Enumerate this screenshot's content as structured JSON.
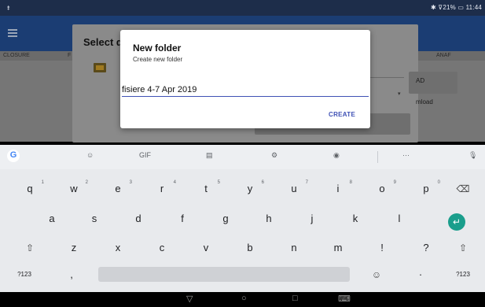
{
  "status_bar": {
    "left_icon": "usb-icon",
    "right_text": "✱ ⊽21% ▭ 11:44"
  },
  "app_bar": {
    "menu_icon": "hamburger-menu-icon"
  },
  "tabs": [
    "CLOSURE",
    "F",
    "ANAF"
  ],
  "background_dialog": {
    "title": "Select d",
    "right_text_1": "AD",
    "right_text_2": "mload"
  },
  "dialog": {
    "title": "New folder",
    "subtitle": "Create new folder",
    "input_value": "fisiere 4-7 Apr 2019",
    "create_label": "CREATE"
  },
  "keyboard": {
    "toolbar": [
      "G",
      "☺",
      "GIF",
      "▤",
      "⚙",
      "◉",
      "···",
      "🎙"
    ],
    "row1": [
      {
        "k": "q",
        "h": "1"
      },
      {
        "k": "w",
        "h": "2"
      },
      {
        "k": "e",
        "h": "3"
      },
      {
        "k": "r",
        "h": "4"
      },
      {
        "k": "t",
        "h": "5"
      },
      {
        "k": "y",
        "h": "6"
      },
      {
        "k": "u",
        "h": "7"
      },
      {
        "k": "i",
        "h": "8"
      },
      {
        "k": "o",
        "h": "9"
      },
      {
        "k": "p",
        "h": "0"
      }
    ],
    "backspace": "⌫",
    "row2": [
      "a",
      "s",
      "d",
      "f",
      "g",
      "h",
      "j",
      "k",
      "l"
    ],
    "enter": "↵",
    "shift": "⇧",
    "row3": [
      "z",
      "x",
      "c",
      "v",
      "b",
      "n",
      "m",
      "!",
      "?"
    ],
    "row4": {
      "sym": "?123",
      "comma": ",",
      "emoji": "☺",
      "period": "·",
      "sym_right": "?123"
    }
  },
  "nav_bar": {
    "back": "▽",
    "home": "○",
    "recents": "□",
    "keyboard": "⌨"
  }
}
